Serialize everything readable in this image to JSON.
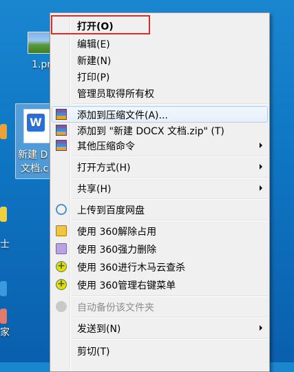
{
  "desktop": {
    "file1_label": "1.pr",
    "file2_label_line1": "新建 D",
    "file2_label_line2": "文档.c",
    "edge_label_1": "士",
    "edge_label_2": "家",
    "word_glyph": "W"
  },
  "menu": {
    "items": [
      {
        "label": "打开(O)"
      },
      {
        "label": "编辑(E)"
      },
      {
        "label": "新建(N)"
      },
      {
        "label": "打印(P)"
      },
      {
        "label": "管理员取得所有权"
      },
      {
        "label": "添加到压缩文件(A)..."
      },
      {
        "label": "添加到 \"新建 DOCX 文档.zip\" (T)"
      },
      {
        "label": "其他压缩命令"
      },
      {
        "label": "打开方式(H)"
      },
      {
        "label": "共享(H)"
      },
      {
        "label": "上传到百度网盘"
      },
      {
        "label": "使用 360解除占用"
      },
      {
        "label": "使用 360强力删除"
      },
      {
        "label": "使用 360进行木马云查杀"
      },
      {
        "label": "使用 360管理右键菜单"
      },
      {
        "label": "自动备份该文件夹"
      },
      {
        "label": "发送到(N)"
      },
      {
        "label": "剪切(T)"
      }
    ]
  },
  "icons": {
    "plus_glyph": "+"
  }
}
